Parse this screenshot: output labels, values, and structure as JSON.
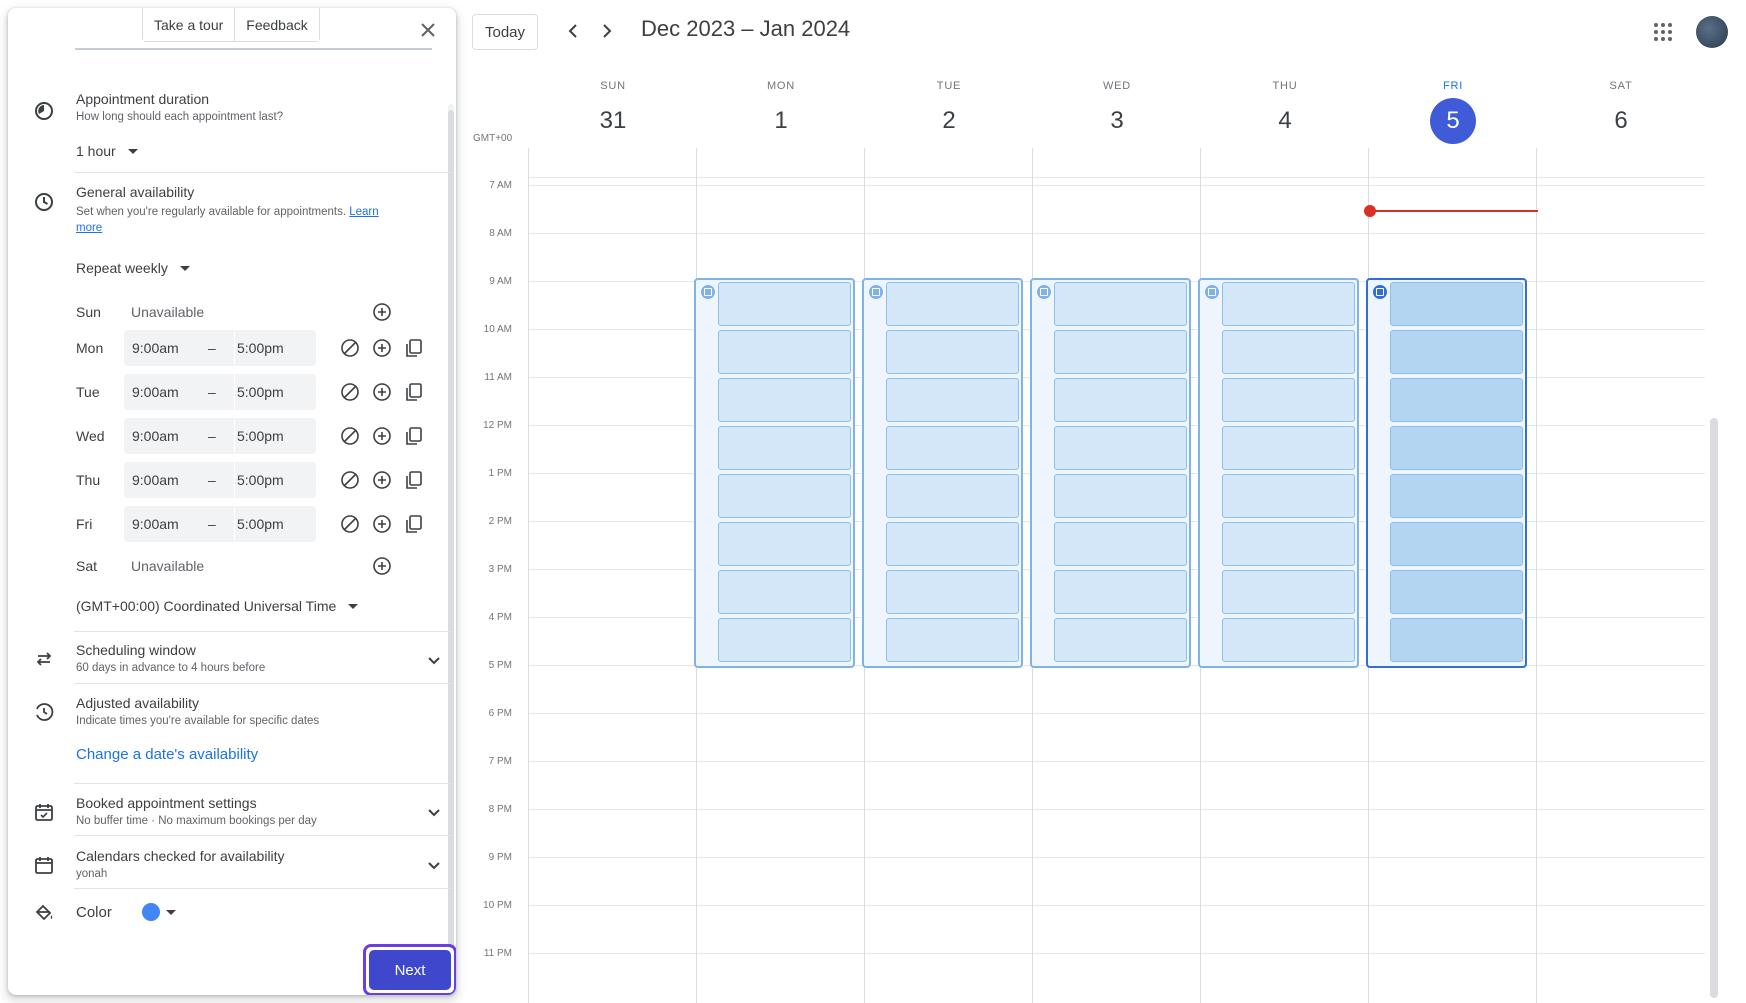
{
  "panel": {
    "top_buttons": {
      "tour": "Take a tour",
      "feedback": "Feedback"
    },
    "duration": {
      "title": "Appointment duration",
      "subtitle": "How long should each appointment last?",
      "value": "1 hour"
    },
    "general": {
      "title": "General availability",
      "subtitle": "Set when you're regularly available for appointments.",
      "link_1": "Learn",
      "link_2": "more",
      "repeat": "Repeat weekly"
    },
    "days": [
      {
        "name": "Sun",
        "unavailable": "Unavailable"
      },
      {
        "name": "Mon",
        "start": "9:00am",
        "dash": "–",
        "end": "5:00pm"
      },
      {
        "name": "Tue",
        "start": "9:00am",
        "dash": "–",
        "end": "5:00pm"
      },
      {
        "name": "Wed",
        "start": "9:00am",
        "dash": "–",
        "end": "5:00pm"
      },
      {
        "name": "Thu",
        "start": "9:00am",
        "dash": "–",
        "end": "5:00pm"
      },
      {
        "name": "Fri",
        "start": "9:00am",
        "dash": "–",
        "end": "5:00pm"
      },
      {
        "name": "Sat",
        "unavailable": "Unavailable"
      }
    ],
    "timezone": "(GMT+00:00) Coordinated Universal Time",
    "scheduling": {
      "title": "Scheduling window",
      "subtitle": "60 days in advance to 4 hours before"
    },
    "adjusted": {
      "title": "Adjusted availability",
      "subtitle": "Indicate times you're available for specific dates",
      "action": "Change a date's availability"
    },
    "booked": {
      "title": "Booked appointment settings",
      "subtitle": "No buffer time · No maximum bookings per day"
    },
    "calendars": {
      "title": "Calendars checked for availability",
      "subtitle": "yonah"
    },
    "color": {
      "label": "Color",
      "value": "#4285f4"
    },
    "next": "Next"
  },
  "calendar": {
    "today_button": "Today",
    "title": "Dec 2023 – Jan 2024",
    "timezone": "GMT+00",
    "days": [
      {
        "dow": "SUN",
        "num": "31"
      },
      {
        "dow": "MON",
        "num": "1"
      },
      {
        "dow": "TUE",
        "num": "2"
      },
      {
        "dow": "WED",
        "num": "3"
      },
      {
        "dow": "THU",
        "num": "4"
      },
      {
        "dow": "FRI",
        "num": "5",
        "today": true
      },
      {
        "dow": "SAT",
        "num": "6"
      }
    ],
    "hours": [
      "7 AM",
      "8 AM",
      "9 AM",
      "10 AM",
      "11 AM",
      "12 PM",
      "1 PM",
      "2 PM",
      "3 PM",
      "4 PM",
      "5 PM",
      "6 PM",
      "7 PM",
      "8 PM",
      "9 PM",
      "10 PM",
      "11 PM"
    ],
    "accent": "#1a73e8",
    "now_color": "#d93025"
  }
}
